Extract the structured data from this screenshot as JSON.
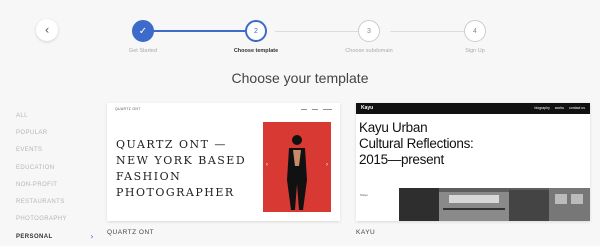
{
  "nav": {
    "back_icon": "chevron-left-icon"
  },
  "stepper": {
    "steps": [
      {
        "label": "Get Started",
        "number": "1",
        "status": "done"
      },
      {
        "label": "Choose template",
        "number": "2",
        "status": "current"
      },
      {
        "label": "Choose subdomain",
        "number": "3",
        "status": "upcoming"
      },
      {
        "label": "Sign Up",
        "number": "4",
        "status": "upcoming"
      }
    ],
    "done_mark": "✓",
    "accent_color": "#3d6bc9"
  },
  "heading": "Choose your template",
  "categories": [
    {
      "label": "ALL",
      "active": false
    },
    {
      "label": "POPULAR",
      "active": false
    },
    {
      "label": "EVENTS",
      "active": false
    },
    {
      "label": "EDUCATION",
      "active": false
    },
    {
      "label": "NON-PROFIT",
      "active": false
    },
    {
      "label": "RESTAURANTS",
      "active": false
    },
    {
      "label": "PHOTOGRAPHY",
      "active": false
    },
    {
      "label": "PERSONAL",
      "active": true
    }
  ],
  "templates": [
    {
      "name": "QUARTZ ONT",
      "preview": {
        "title_lines": [
          "QUARTZ ONT —",
          "NEW YORK BASED",
          "FASHION",
          "PHOTOGRAPHER"
        ],
        "accent_color": "#d83a33"
      }
    },
    {
      "name": "KAYU",
      "preview": {
        "logo": "Kayu",
        "menu": [
          "biography",
          "works",
          "contact us"
        ],
        "title_lines": [
          "Kayu Urban",
          "Cultural Reflections:",
          "2015—present"
        ],
        "small_text": "Tokyo"
      }
    }
  ]
}
